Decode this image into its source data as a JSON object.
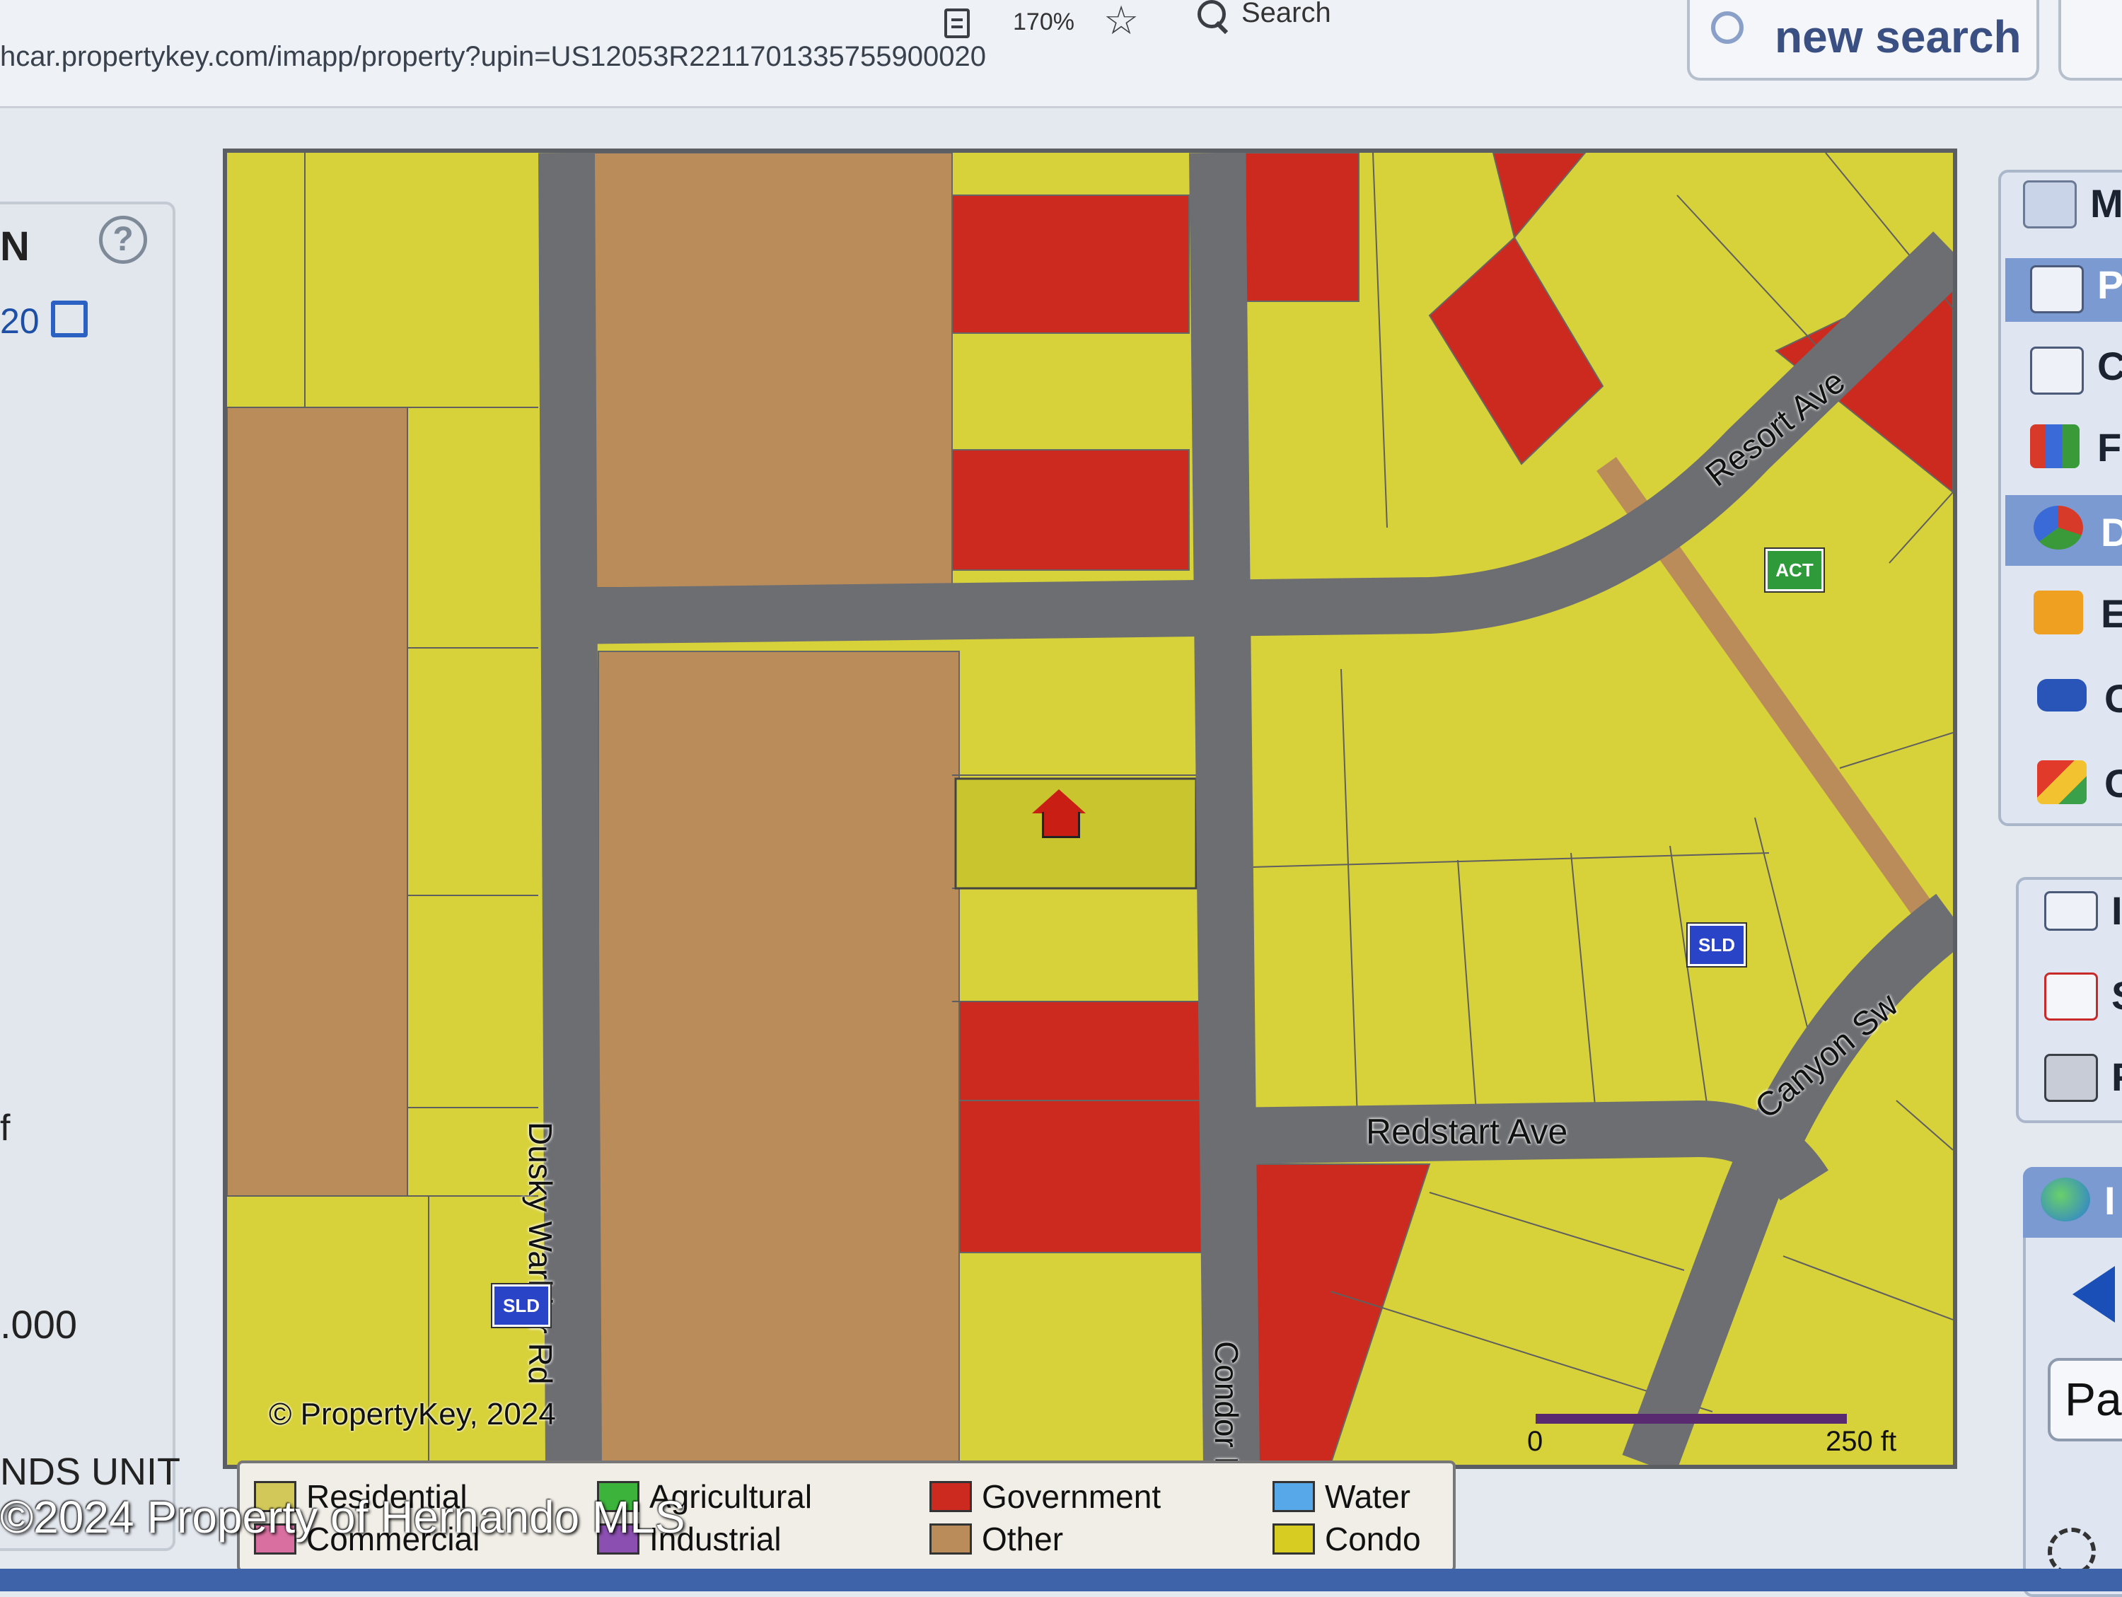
{
  "browser": {
    "url": "hcar.propertykey.com/imapp/property?upin=US12053R2211701335755900020",
    "zoom": "170%",
    "search_label": "Search",
    "new_search_label": "new search"
  },
  "left_panel": {
    "heading": "N",
    "help": "?",
    "link_text": "20",
    "fragment_f": "f",
    "price_fragment": ".000",
    "unit_fragment": "NDS UNIT"
  },
  "map": {
    "streets": {
      "dusky": "Dusky Warbler Rd",
      "condor": "Condor Rd",
      "resort": "Resort Ave",
      "redstart": "Redstart Ave",
      "canyon": "Canyon Sw"
    },
    "markers": {
      "act": "ACT",
      "sld": "SLD"
    },
    "copyright": "© PropertyKey, 2024",
    "scale_start": "0",
    "scale_end": "250 ft",
    "colors": {
      "residential": "#d8d23a",
      "government": "#cc2a1e",
      "other": "#b98c5a",
      "road": "#6d6e72"
    }
  },
  "legend": {
    "items": [
      {
        "label": "Residential",
        "color": "#d2c85a"
      },
      {
        "label": "Commercial",
        "color": "#d86fa0"
      },
      {
        "label": "Agricultural",
        "color": "#3cb43c"
      },
      {
        "label": "Industrial",
        "color": "#8a4fb0"
      },
      {
        "label": "Government",
        "color": "#cc2a1e"
      },
      {
        "label": "Other",
        "color": "#b98c5a"
      },
      {
        "label": "Water",
        "color": "#56a8e8"
      },
      {
        "label": "Condo",
        "color": "#d6cc22"
      }
    ]
  },
  "watermark": "©2024 Property of Hernando MLS",
  "right_toolbar": {
    "labels": [
      "M",
      "P",
      "C",
      "F",
      "D",
      "E",
      "C",
      "C",
      "I",
      "S",
      "F",
      "I"
    ],
    "par_label": "Par"
  }
}
